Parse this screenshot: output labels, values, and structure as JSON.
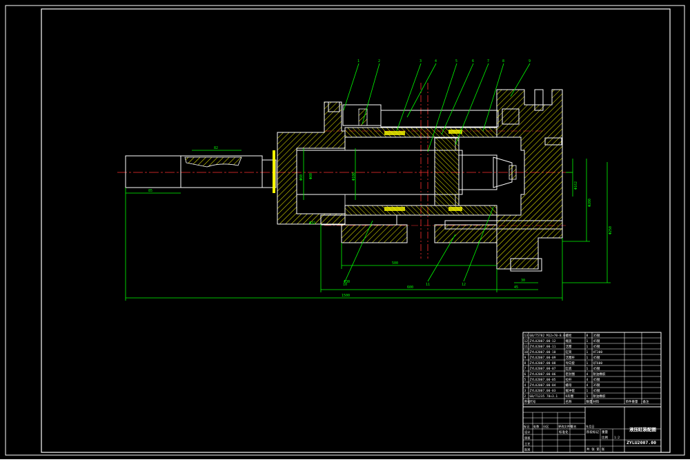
{
  "drawing": {
    "title": "液压缸装配图",
    "drawing_number": "ZYLU2007.00",
    "balloons": [
      "1",
      "2",
      "3",
      "4",
      "5",
      "6",
      "7",
      "8",
      "9",
      "10",
      "11",
      "12",
      "13"
    ],
    "dimensions": {
      "overall_length": "1500",
      "rod_length": "85",
      "stroke": "500",
      "body_length": "600",
      "flange_offset": "45",
      "small_gap": "30",
      "rod_section": "82",
      "bore_dia": "Φ80",
      "piston_dia": "Φ100",
      "dia_left": "Φ60",
      "dia_right_1": "Φ162",
      "dia_right_2": "Φ200",
      "dia_right_3": "Φ250",
      "left_note": "Φ32",
      "bottom_left": "Φ30"
    }
  },
  "parts_table": {
    "header": [
      "序号",
      "代号",
      "名称",
      "数量",
      "材料",
      "单件重量",
      "备注"
    ],
    "rows": [
      {
        "no": "13",
        "code": "GB/T5782 M12×70-8.8",
        "name": "螺栓",
        "qty": "8",
        "mat": "35钢"
      },
      {
        "no": "12",
        "code": "ZYLU2007.00-12",
        "name": "端盖",
        "qty": "1",
        "mat": "45钢"
      },
      {
        "no": "11",
        "code": "ZYLU2007.00-11",
        "name": "活塞",
        "qty": "1",
        "mat": "45钢"
      },
      {
        "no": "10",
        "code": "ZYLU2007.00-10",
        "name": "缸筒",
        "qty": "1",
        "mat": "HT300"
      },
      {
        "no": "9",
        "code": "ZYLU2007.00-09",
        "name": "活塞杆",
        "qty": "1",
        "mat": "45钢"
      },
      {
        "no": "8",
        "code": "ZYLU2007.00-08",
        "name": "导向套",
        "qty": "1",
        "mat": "QT600"
      },
      {
        "no": "7",
        "code": "ZYLU2007.00-07",
        "name": "缸底",
        "qty": "1",
        "mat": "45钢"
      },
      {
        "no": "6",
        "code": "ZYLU2007.00-06",
        "name": "密封圈",
        "qty": "4",
        "mat": "耐油橡胶"
      },
      {
        "no": "5",
        "code": "ZYLU2007.00-05",
        "name": "拉杆",
        "qty": "4",
        "mat": "45钢"
      },
      {
        "no": "4",
        "code": "ZYLU2007.00-04",
        "name": "螺母",
        "qty": "4",
        "mat": "35钢"
      },
      {
        "no": "3",
        "code": "ZYLU2007.00-03",
        "name": "缓冲套",
        "qty": "1",
        "mat": "45钢"
      },
      {
        "no": "2",
        "code": "GB/T1235 70×3.1",
        "name": "O形圈",
        "qty": "1",
        "mat": "耐油橡胶"
      }
    ],
    "title_block": {
      "left_labels": [
        "标记",
        "处数",
        "分区",
        "更改文件号",
        "签名",
        "年月日"
      ],
      "role_labels": [
        "设计",
        "审核",
        "工艺",
        "批准"
      ],
      "std_label": "标准化",
      "stage_label": "阶段标记",
      "weight_label": "重量",
      "scale_label": "比例",
      "scale": "1:2",
      "sheet_label": "共 张  第 张"
    }
  }
}
